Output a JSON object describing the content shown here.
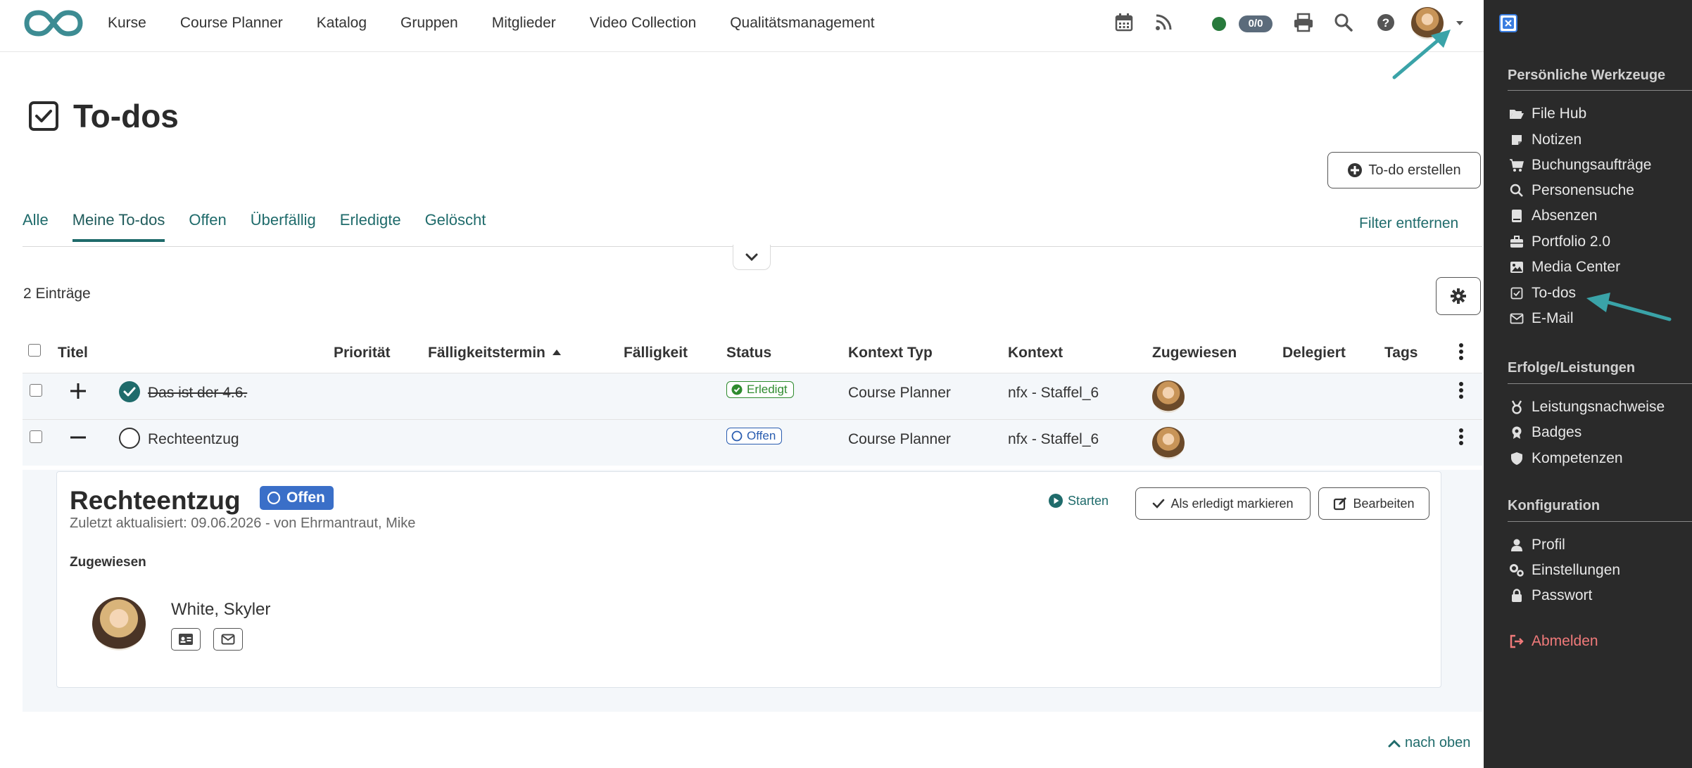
{
  "nav": {
    "links": [
      "Kurse",
      "Course Planner",
      "Katalog",
      "Gruppen",
      "Mitglieder",
      "Video Collection",
      "Qualitätsmanagement"
    ],
    "counter": "0/0"
  },
  "page": {
    "title": "To-dos",
    "create_button": "To-do erstellen",
    "tabs": [
      "Alle",
      "Meine To-dos",
      "Offen",
      "Überfällig",
      "Erledigte",
      "Gelöscht"
    ],
    "active_tab": "Meine To-dos",
    "filter_remove": "Filter entfernen",
    "entries": "2 Einträge"
  },
  "table": {
    "headers": [
      "Titel",
      "Priorität",
      "Fälligkeitstermin",
      "Fälligkeit",
      "Status",
      "Kontext Typ",
      "Kontext",
      "Zugewiesen",
      "Delegiert",
      "Tags"
    ],
    "rows": [
      {
        "title": "Das ist der 4.6.",
        "status": "Erledigt",
        "context_type": "Course Planner",
        "context": "nfx - Staffel_6",
        "done": true
      },
      {
        "title": "Rechteentzug",
        "status": "Offen",
        "context_type": "Course Planner",
        "context": "nfx - Staffel_6",
        "done": false
      }
    ]
  },
  "detail": {
    "title": "Rechteentzug",
    "status": "Offen",
    "updated": "Zuletzt aktualisiert: 09.06.2026 - von Ehrmantraut, Mike",
    "start": "Starten",
    "mark_done": "Als erledigt markieren",
    "edit": "Bearbeiten",
    "assigned_heading": "Zugewiesen",
    "assignee": "White, Skyler"
  },
  "footer": {
    "to_top": "nach oben"
  },
  "sidebar": {
    "section1": "Persönliche Werkzeuge",
    "items1": [
      "File Hub",
      "Notizen",
      "Buchungsaufträge",
      "Personensuche",
      "Absenzen",
      "Portfolio 2.0",
      "Media Center",
      "To-dos",
      "E-Mail"
    ],
    "section2": "Erfolge/Leistungen",
    "items2": [
      "Leistungsnachweise",
      "Badges",
      "Kompetenzen"
    ],
    "section3": "Konfiguration",
    "items3": [
      "Profil",
      "Einstellungen",
      "Passwort"
    ],
    "logout": "Abmelden"
  },
  "colors": {
    "accent": "#1f6b6b",
    "arrow": "#3aa3a8",
    "sidebar_bg": "#2a2a2a",
    "logo": "#3d8c93"
  }
}
